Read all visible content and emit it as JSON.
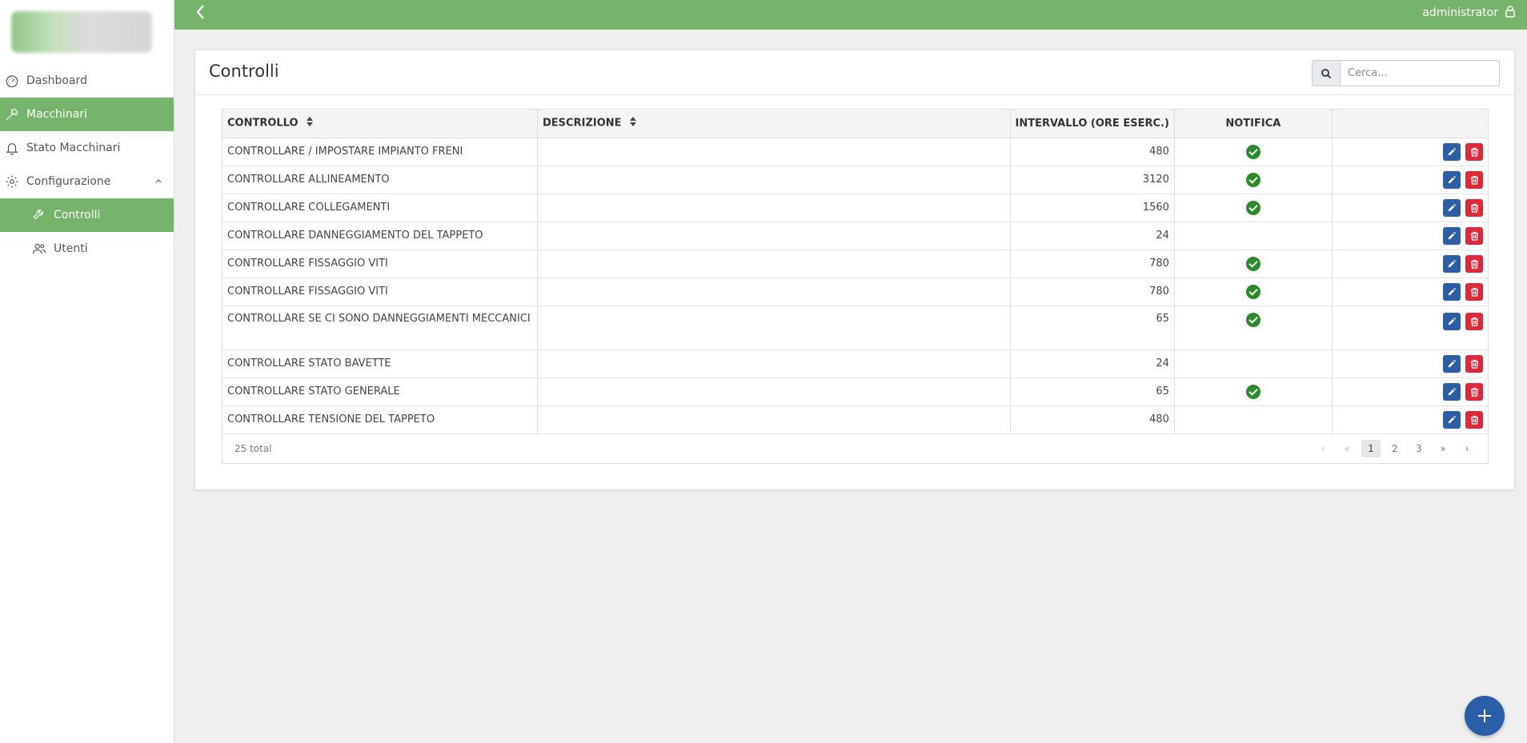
{
  "sidebar": {
    "items": [
      {
        "label": "Dashboard"
      },
      {
        "label": "Macchinari"
      },
      {
        "label": "Stato Macchinari"
      },
      {
        "label": "Configurazione"
      },
      {
        "label": "Controlli"
      },
      {
        "label": "Utenti"
      }
    ]
  },
  "topbar": {
    "user": "administrator"
  },
  "page": {
    "title": "Controlli",
    "search_placeholder": "Cerca..."
  },
  "table": {
    "headers": [
      "CONTROLLO",
      "DESCRIZIONE",
      "INTERVALLO (ORE ESERC.)",
      "NOTIFICA"
    ],
    "rows": [
      {
        "controllo": "CONTROLLARE / IMPOSTARE IMPIANTO FRENI",
        "descrizione": "",
        "intervallo": "480",
        "notifica": true
      },
      {
        "controllo": "CONTROLLARE ALLINEAMENTO",
        "descrizione": "",
        "intervallo": "3120",
        "notifica": true
      },
      {
        "controllo": "CONTROLLARE COLLEGAMENTI",
        "descrizione": "",
        "intervallo": "1560",
        "notifica": true
      },
      {
        "controllo": "CONTROLLARE DANNEGGIAMENTO DEL TAPPETO",
        "descrizione": "",
        "intervallo": "24",
        "notifica": false
      },
      {
        "controllo": "CONTROLLARE FISSAGGIO VITI",
        "descrizione": "",
        "intervallo": "780",
        "notifica": true
      },
      {
        "controllo": "CONTROLLARE FISSAGGIO VITI",
        "descrizione": "",
        "intervallo": "780",
        "notifica": true
      },
      {
        "controllo": "CONTROLLARE SE CI SONO DANNEGGIAMENTI MECCANICI",
        "descrizione": "",
        "intervallo": "65",
        "notifica": true
      },
      {
        "controllo": "CONTROLLARE STATO BAVETTE",
        "descrizione": "",
        "intervallo": "24",
        "notifica": false
      },
      {
        "controllo": "CONTROLLARE STATO GENERALE",
        "descrizione": "",
        "intervallo": "65",
        "notifica": true
      },
      {
        "controllo": "CONTROLLARE TENSIONE DEL TAPPETO",
        "descrizione": "",
        "intervallo": "480",
        "notifica": false
      }
    ],
    "total_label": "25 total",
    "pager": {
      "first": "‹",
      "prev": "«",
      "pages": [
        "1",
        "2",
        "3"
      ],
      "current": "1",
      "next": "»",
      "last": "›"
    }
  },
  "colors": {
    "brand_green": "#76b46b",
    "primary_blue": "#2c5ea8",
    "danger_red": "#dc2a3a",
    "check_green": "#2a8a2a"
  },
  "icons": {
    "dashboard": "speedometer-icon",
    "macchinari": "hammer-icon",
    "stato": "bell-icon",
    "configurazione": "gear-icon",
    "controlli": "wrench-icon",
    "utenti": "users-icon"
  }
}
